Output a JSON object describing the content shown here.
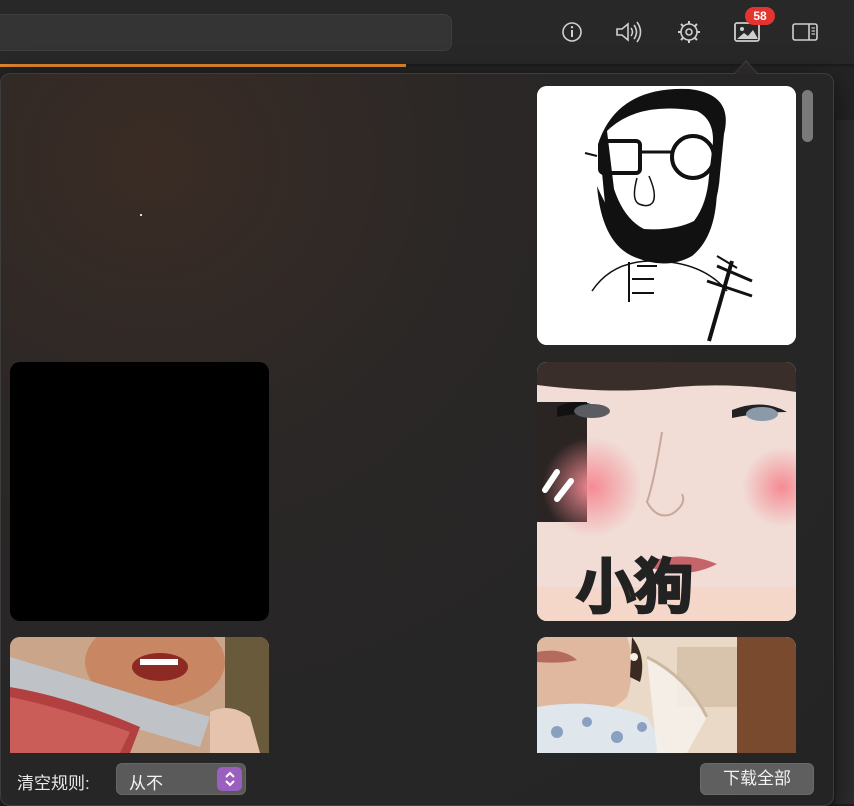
{
  "toolbar": {
    "badge_count": "58",
    "icons": [
      "info-icon",
      "speaker-icon",
      "settings-icon",
      "image-gallery-icon",
      "sidebar-icon"
    ]
  },
  "gallery": {
    "items": [
      {
        "kind": "sketch-portrait"
      },
      {
        "kind": "black-frame"
      },
      {
        "kind": "face-closeup",
        "caption": "小狗"
      },
      {
        "kind": "meat-cutting"
      },
      {
        "kind": "woman-portrait"
      }
    ]
  },
  "footer": {
    "clear_rule_label": "清空规则:",
    "clear_rule_value": "从不",
    "download_all_label": "下载全部"
  },
  "colors": {
    "accent_progress": "#e0892f",
    "badge": "#e3342f",
    "select_accent": "#9b5fbf"
  }
}
